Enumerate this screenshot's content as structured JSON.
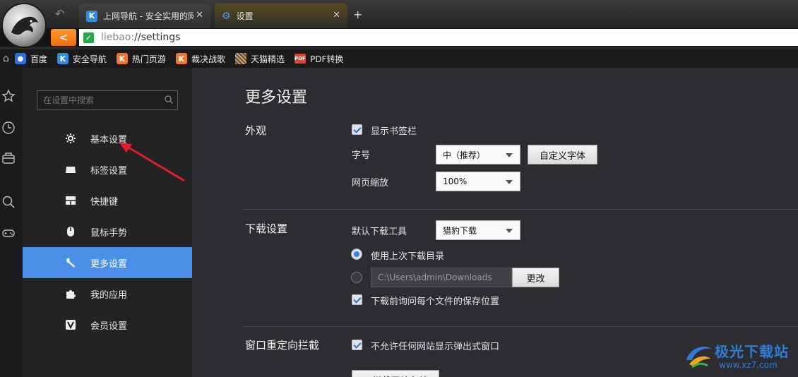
{
  "browser": {
    "tabs": [
      {
        "title": "上网导航 - 安全实用的网",
        "icon": "k-shield-icon"
      },
      {
        "title": "设置",
        "icon": "gear-icon"
      }
    ],
    "new_tab_label": "+",
    "url_scheme": "liebao:",
    "url_path": "//settings"
  },
  "bookmarks": [
    {
      "label": "百度",
      "icon": "baidu-paw-icon"
    },
    {
      "label": "安全导航",
      "icon": "k-shield-icon"
    },
    {
      "label": "热门页游",
      "icon": "k-shield-orange-icon"
    },
    {
      "label": "裁决战歌",
      "icon": "k-shield-orange-icon"
    },
    {
      "label": "天猫精选",
      "icon": "tmall-icon"
    },
    {
      "label": "PDF转换",
      "icon": "pdf-icon"
    }
  ],
  "sidebar": {
    "search_placeholder": "在设置中搜索",
    "items": [
      {
        "label": "基本设置",
        "icon": "gear-icon",
        "active": false
      },
      {
        "label": "标签设置",
        "icon": "tab-icon",
        "active": false
      },
      {
        "label": "快捷键",
        "icon": "keyboard-icon",
        "active": false
      },
      {
        "label": "鼠标手势",
        "icon": "mouse-icon",
        "active": false
      },
      {
        "label": "更多设置",
        "icon": "wrench-icon",
        "active": true
      },
      {
        "label": "我的应用",
        "icon": "puzzle-icon",
        "active": false
      },
      {
        "label": "会员设置",
        "icon": "vip-icon",
        "active": false
      }
    ]
  },
  "content": {
    "title": "更多设置",
    "appearance": {
      "section": "外观",
      "show_bookmarks_bar": "显示书签栏",
      "font_size_label": "字号",
      "font_size_value": "中（推荐）",
      "custom_font_button": "自定义字体",
      "zoom_label": "网页缩放",
      "zoom_value": "100%"
    },
    "download": {
      "section": "下载设置",
      "tool_label": "默认下载工具",
      "tool_value": "猎豹下载",
      "use_last_dir": "使用上次下载目录",
      "path_value": "C:\\Users\\admin\\Downloads",
      "change_button": "更改",
      "ask_location": "下载前询问每个文件的保存位置"
    },
    "popup": {
      "section": "窗口重定向拦截",
      "block_popups": "不允许任何网站显示弹出式窗口",
      "partial_button": "不拦截网站名单"
    }
  },
  "watermark": {
    "title": "极光下载站",
    "url": "www.xz7.com"
  },
  "colors": {
    "accent": "#4a8fe8",
    "annotation_arrow": "#e02020",
    "orange_back": "#ee6e10"
  }
}
